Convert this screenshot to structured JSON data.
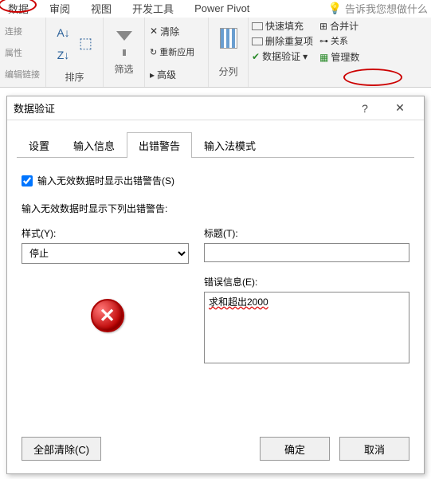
{
  "ribbon": {
    "tabs": [
      "数据",
      "审阅",
      "视图",
      "开发工具",
      "Power Pivot"
    ],
    "tell_me": "告诉我您想做什么",
    "groups": {
      "links_items": [
        "连接",
        "属性",
        "编辑链接"
      ],
      "sort_btn_asc": "A↓Z",
      "sort_btn_desc": "Z↓A",
      "sort_label": "排序",
      "filter_label": "筛选",
      "clear": "清除",
      "reapply": "重新应用",
      "advanced": "高级",
      "text2col": "分列",
      "flash_fill": "快速填充",
      "remove_dup": "删除重复项",
      "data_val": "数据验证",
      "consolidate": "合并计",
      "relations": "关系",
      "manage": "管理数"
    }
  },
  "dialog": {
    "title": "数据验证",
    "help": "?",
    "tabs": [
      "设置",
      "输入信息",
      "出错警告",
      "输入法模式"
    ],
    "active_tab": 2,
    "checkbox_label": "输入无效数据时显示出错警告(S)",
    "section": "输入无效数据时显示下列出错警告:",
    "style_label": "样式(Y):",
    "style_value": "停止",
    "title_label": "标题(T):",
    "title_value": "",
    "msg_label": "错误信息(E):",
    "msg_value": "求和超出2000",
    "clear_all": "全部清除(C)",
    "ok": "确定",
    "cancel": "取消"
  }
}
